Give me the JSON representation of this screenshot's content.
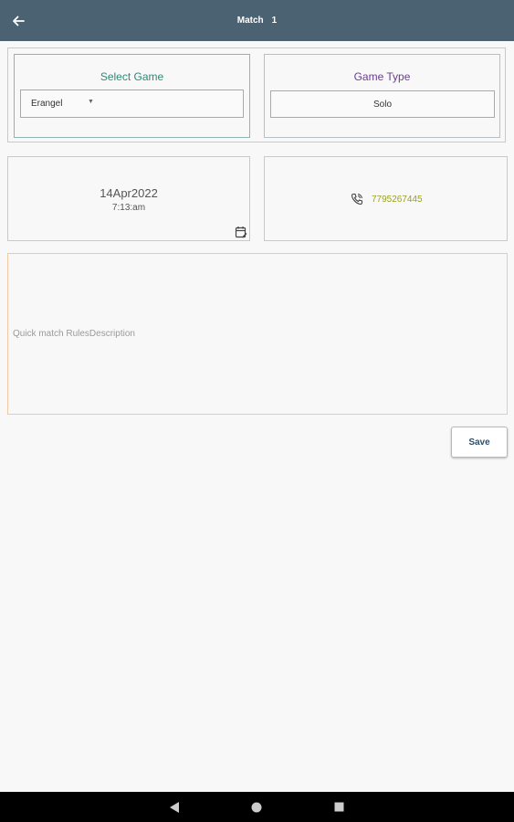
{
  "app_bar": {
    "title": "Match",
    "title_number": "1",
    "back_icon": "arrow-left-icon",
    "color": "#4a6272"
  },
  "select_game": {
    "label": "Select Game",
    "selected": "Erangel",
    "caret_icon": "dropdown-caret-icon"
  },
  "game_type": {
    "label": "Game Type",
    "value": "Solo"
  },
  "datetime": {
    "date": "14Apr2022",
    "time": "7:13:am",
    "calendar_icon": "calendar-edit-icon"
  },
  "contact": {
    "phone_icon": "phone-call-icon",
    "phone_number": "7795267445",
    "color": "#9aa11f"
  },
  "rules": {
    "placeholder": "Quick match RulesDescription"
  },
  "actions": {
    "save_label": "Save"
  },
  "system_nav": {
    "back_icon": "nav-back-triangle-icon",
    "home_icon": "nav-home-circle-icon",
    "recent_icon": "nav-recents-square-icon"
  }
}
